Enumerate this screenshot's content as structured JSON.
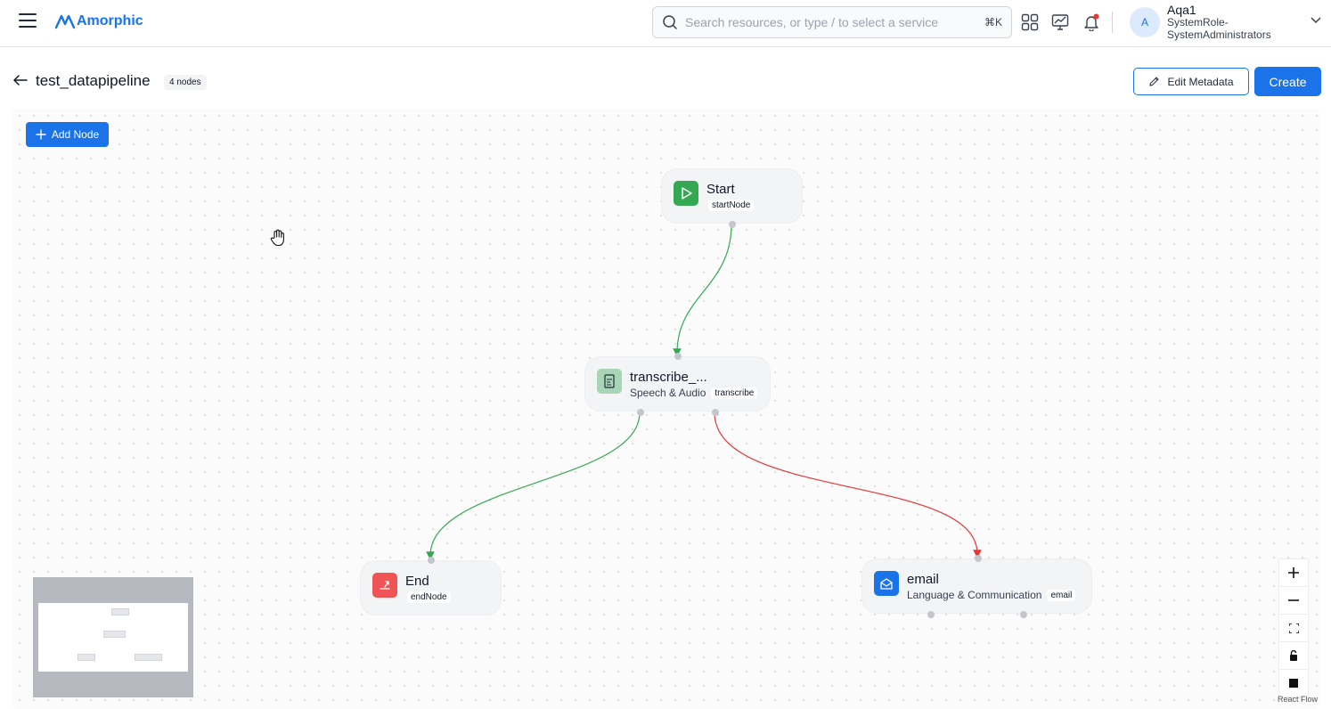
{
  "app": {
    "brand": "Amorphic"
  },
  "header": {
    "search": {
      "placeholder": "Search resources, or type / to select a service",
      "shortcut": "⌘K"
    },
    "icons": [
      "apps-grid-icon",
      "monitor-chart-icon",
      "bell-icon"
    ],
    "notification_dot_color": "#e53935",
    "user": {
      "avatar_letter": "A",
      "name": "Aqa1",
      "role_line1": "SystemRole-",
      "role_line2": "SystemAdministrators"
    }
  },
  "page": {
    "title": "test_datapipeline",
    "node_count": "4 nodes",
    "edit_button": "Edit Metadata",
    "create_button": "Create"
  },
  "canvas": {
    "add_node_button": "Add Node",
    "nodes": [
      {
        "id": "start",
        "title": "Start",
        "subtitle": "",
        "tag": "startNode",
        "icon": "play-icon",
        "color": "#34a853"
      },
      {
        "id": "transcribe",
        "title": "transcribe_...",
        "subtitle": "Speech & Audio",
        "tag": "transcribe",
        "icon": "audio-document-icon",
        "color": "#a8d5b5"
      },
      {
        "id": "end",
        "title": "End",
        "subtitle": "",
        "tag": "endNode",
        "icon": "exit-icon",
        "color": "#f05454"
      },
      {
        "id": "email",
        "title": "email",
        "subtitle": "Language & Communication",
        "tag": "email",
        "icon": "mail-open-icon",
        "color": "#1a73e8"
      }
    ],
    "edges": [
      {
        "from": "start",
        "to": "transcribe",
        "color": "#34a853"
      },
      {
        "from": "transcribe",
        "to": "end",
        "color": "#34a853"
      },
      {
        "from": "transcribe",
        "to": "email",
        "color": "#e53935"
      }
    ],
    "controls": [
      "zoom-in-icon",
      "zoom-out-icon",
      "fit-view-icon",
      "lock-icon",
      "square-icon"
    ],
    "attribution": "React Flow"
  },
  "colors": {
    "accent": "#1a73e8"
  }
}
